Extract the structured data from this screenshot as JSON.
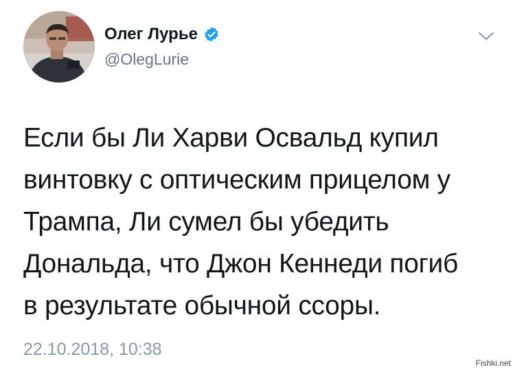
{
  "tweet": {
    "author": {
      "display_name": "Олег Лурье",
      "username": "@OlegLurie",
      "verified": true,
      "avatar_icon": "user-photo"
    },
    "menu_icon": "chevron-down-icon",
    "text_lines": [
      "Если бы Ли Харви Освальд купил",
      "винтовку с оптическим прицелом у",
      "Трампа, Ли сумел бы убедить",
      "Дональда, что Джон Кеннеди погиб",
      "в результате обычной ссоры."
    ],
    "timestamp": "22.10.2018, 10:38"
  },
  "watermark": "Fishki.net",
  "colors": {
    "verified_blue": "#1da1f2",
    "secondary_text": "#657786",
    "timestamp_text": "#8899a6",
    "primary_text": "#14171a"
  }
}
